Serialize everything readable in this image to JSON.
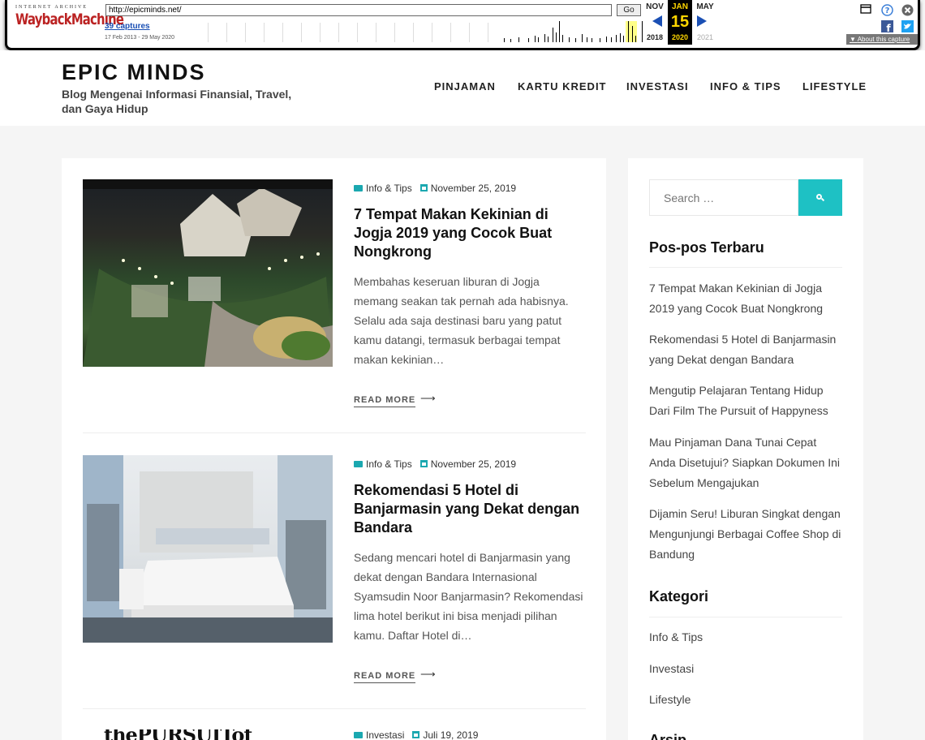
{
  "wayback": {
    "logo_top": "INTERNET ARCHIVE",
    "logo_main": "WaybackMachine",
    "url": "http://epicminds.net/",
    "go_label": "Go",
    "captures": "39 captures",
    "range": "17 Feb 2013 - 29 May 2020",
    "prev_month": "NOV",
    "cur_month": "JAN",
    "next_month": "MAY",
    "cur_day": "15",
    "prev_year": "2018",
    "cur_year": "2020",
    "next_year": "2021",
    "about": "About this capture"
  },
  "site": {
    "title": "EPIC MINDS",
    "description": "Blog Mengenai Informasi Finansial, Travel, dan Gaya Hidup",
    "nav": [
      "PINJAMAN",
      "KARTU KREDIT",
      "INVESTASI",
      "INFO & TIPS",
      "LIFESTYLE"
    ]
  },
  "posts": [
    {
      "category": "Info & Tips",
      "date": "November 25, 2019",
      "title": "7 Tempat Makan Kekinian di Jogja 2019 yang Cocok Buat Nongkrong",
      "excerpt": "Membahas keseruan liburan di Jogja memang seakan tak pernah ada habisnya. Selalu ada saja destinasi baru yang patut kamu datangi, termasuk berbagai tempat makan kekinian…",
      "more": "READ MORE"
    },
    {
      "category": "Info & Tips",
      "date": "November 25, 2019",
      "title": "Rekomendasi 5 Hotel di Banjarmasin yang Dekat dengan Bandara",
      "excerpt": "Sedang mencari hotel di Banjarmasin yang dekat dengan Bandara Internasional Syamsudin Noor Banjarmasin? Rekomendasi lima hotel berikut ini bisa menjadi pilihan kamu. Daftar Hotel di…",
      "more": "READ MORE"
    },
    {
      "category": "Investasi",
      "date": "Juli 19, 2019",
      "image_text": "thePURSUITof"
    }
  ],
  "sidebar": {
    "search_placeholder": "Search …",
    "recent_title": "Pos-pos Terbaru",
    "recent": [
      "7 Tempat Makan Kekinian di Jogja 2019 yang Cocok Buat Nongkrong",
      "Rekomendasi 5 Hotel di Banjarmasin yang Dekat dengan Bandara",
      "Mengutip Pelajaran Tentang Hidup Dari Film The Pursuit of Happyness",
      "Mau Pinjaman Dana Tunai Cepat Anda Disetujui? Siapkan Dokumen Ini Sebelum Mengajukan",
      "Dijamin Seru! Liburan Singkat dengan Mengunjungi Berbagai Coffee Shop di Bandung"
    ],
    "cat_title": "Kategori",
    "categories": [
      "Info & Tips",
      "Investasi",
      "Lifestyle"
    ],
    "archive_title": "Arsip"
  },
  "colors": {
    "accent": "#1ec1c4",
    "wayback_link": "#1a4fb4",
    "wayback_red": "#b22222"
  },
  "icons": [
    "calendar-toggle-icon",
    "help-icon",
    "close-icon",
    "facebook-icon",
    "twitter-icon",
    "folder-icon",
    "calendar-icon",
    "search-icon",
    "arrow-right-icon"
  ]
}
